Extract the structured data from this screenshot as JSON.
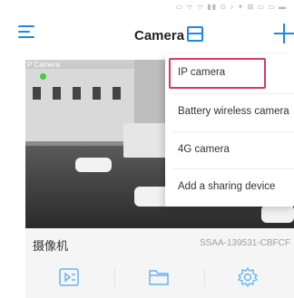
{
  "status_bar": {
    "icons_text": "▭ ᯤ ᯤ ▮▮ ⊙ ♪ ✦ ⊠ ▭ ▭ ▬"
  },
  "header": {
    "title": "Camera",
    "menu_icon": "hamburger-menu-icon",
    "layout_icon": "layout-toggle-icon",
    "add_icon": "plus-icon",
    "accent_color": "#1e88e5"
  },
  "camera_card": {
    "feed_label": "P Camera",
    "rec_label": "...",
    "name": "摄像机",
    "device_id": "SSAA-139531-CBFCF",
    "actions": [
      {
        "name": "playback-icon"
      },
      {
        "name": "folder-icon"
      },
      {
        "name": "settings-icon"
      }
    ]
  },
  "dropdown": {
    "items": [
      {
        "label": "IP camera",
        "highlighted": true
      },
      {
        "label": "Battery wireless camera"
      },
      {
        "label": "4G camera"
      },
      {
        "label": "Add a sharing device"
      }
    ],
    "highlight_color": "#d33a6a"
  }
}
